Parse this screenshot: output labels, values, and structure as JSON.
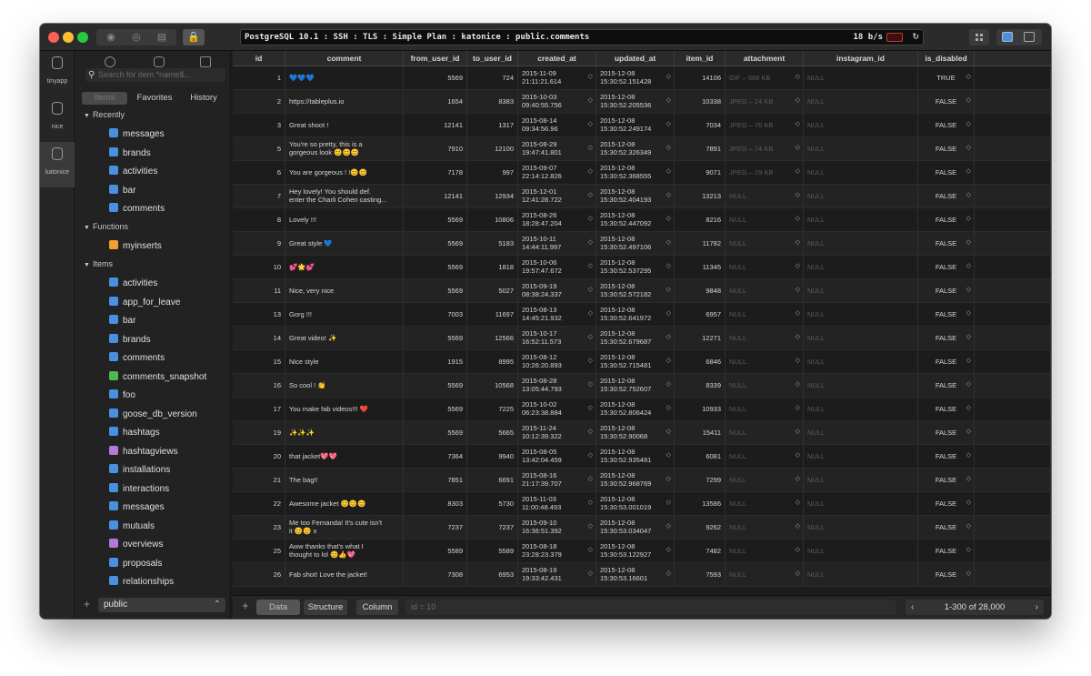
{
  "titlebar": {
    "connection": "PostgreSQL 10.1 : SSH : TLS : Simple Plan : katonice : public.comments",
    "speed": "18 b/s",
    "refresh_icon": "↻"
  },
  "rail": [
    {
      "label": "tinyapp"
    },
    {
      "label": "nice"
    },
    {
      "label": "katonice"
    }
  ],
  "sidebar": {
    "search_placeholder": "Search for item  *name$...",
    "segments": [
      "Items",
      "Favorites",
      "History"
    ],
    "groups": [
      {
        "title": "Recently",
        "items": [
          {
            "name": "messages",
            "color": "#4a90e2"
          },
          {
            "name": "brands",
            "color": "#4a90e2"
          },
          {
            "name": "activities",
            "color": "#4a90e2"
          },
          {
            "name": "bar",
            "color": "#4a90e2"
          },
          {
            "name": "comments",
            "color": "#4a90e2"
          }
        ]
      },
      {
        "title": "Functions",
        "items": [
          {
            "name": "myinserts",
            "color": "#f0a030"
          }
        ]
      },
      {
        "title": "Items",
        "items": [
          {
            "name": "activities",
            "color": "#4a90e2"
          },
          {
            "name": "app_for_leave",
            "color": "#4a90e2"
          },
          {
            "name": "bar",
            "color": "#4a90e2"
          },
          {
            "name": "brands",
            "color": "#4a90e2"
          },
          {
            "name": "comments",
            "color": "#4a90e2"
          },
          {
            "name": "comments_snapshot",
            "color": "#4cbb4c"
          },
          {
            "name": "foo",
            "color": "#4a90e2"
          },
          {
            "name": "goose_db_version",
            "color": "#4a90e2"
          },
          {
            "name": "hashtags",
            "color": "#4a90e2"
          },
          {
            "name": "hashtagviews",
            "color": "#b07ad8"
          },
          {
            "name": "installations",
            "color": "#4a90e2"
          },
          {
            "name": "interactions",
            "color": "#4a90e2"
          },
          {
            "name": "messages",
            "color": "#4a90e2"
          },
          {
            "name": "mutuals",
            "color": "#4a90e2"
          },
          {
            "name": "overviews",
            "color": "#b07ad8"
          },
          {
            "name": "proposals",
            "color": "#4a90e2"
          },
          {
            "name": "relationships",
            "color": "#4a90e2"
          }
        ]
      }
    ],
    "footer": {
      "add": "+",
      "schema": "public",
      "stepper": "⌃"
    }
  },
  "grid": {
    "columns": [
      "id",
      "comment",
      "from_user_id",
      "to_user_id",
      "created_at",
      "updated_at",
      "item_id",
      "attachment",
      "instagram_id",
      "is_disabled"
    ],
    "stepper": "◇",
    "rows": [
      {
        "id": "1",
        "comment": "💙💙💙",
        "from": "5569",
        "to": "724",
        "created": "2015-11-09\n21:11:21.614",
        "updated": "2015-12-08\n15:30:52.151428",
        "item": "14106",
        "attachment": "GIF – 588 KB",
        "instagram": "NULL",
        "disabled": "TRUE"
      },
      {
        "id": "2",
        "comment": "https://tableplus.io",
        "from": "1654",
        "to": "8383",
        "created": "2015-10-03\n09:40:55.756",
        "updated": "2015-12-08\n15:30:52.205536",
        "item": "10338",
        "attachment": "JPEG – 24 KB",
        "instagram": "NULL",
        "disabled": "FALSE"
      },
      {
        "id": "3",
        "comment": "Great shoot !",
        "from": "12141",
        "to": "1317",
        "created": "2015-08-14\n09:34:56.96",
        "updated": "2015-12-08\n15:30:52.249174",
        "item": "7034",
        "attachment": "JPEG – 76 KB",
        "instagram": "NULL",
        "disabled": "FALSE"
      },
      {
        "id": "5",
        "comment": "You're so pretty, this is a\ngorgeous look 😊😊😊",
        "from": "7910",
        "to": "12100",
        "created": "2015-08-29\n19:47:41.801",
        "updated": "2015-12-08\n15:30:52.326349",
        "item": "7891",
        "attachment": "JPEG – 74 KB",
        "instagram": "NULL",
        "disabled": "FALSE"
      },
      {
        "id": "6",
        "comment": "You are gorgeous ! !😊😊",
        "from": "7178",
        "to": "997",
        "created": "2015-09-07\n22:14:12.826",
        "updated": "2015-12-08\n15:30:52.368555",
        "item": "9071",
        "attachment": "JPEG – 29 KB",
        "instagram": "NULL",
        "disabled": "FALSE"
      },
      {
        "id": "7",
        "comment": "Hey lovely! You should def.\nenter the Charli Cohen casting...",
        "from": "12141",
        "to": "12934",
        "created": "2015-12-01\n12:41:28.722",
        "updated": "2015-12-08\n15:30:52.404193",
        "item": "13213",
        "attachment": "NULL",
        "instagram": "NULL",
        "disabled": "FALSE"
      },
      {
        "id": "8",
        "comment": "Lovely !!!",
        "from": "5569",
        "to": "10806",
        "created": "2015-08-26\n18:28:47.204",
        "updated": "2015-12-08\n15:30:52.447092",
        "item": "8216",
        "attachment": "NULL",
        "instagram": "NULL",
        "disabled": "FALSE"
      },
      {
        "id": "9",
        "comment": "Great style 💙",
        "from": "5569",
        "to": "5183",
        "created": "2015-10-11\n14:44:11.997",
        "updated": "2015-12-08\n15:30:52.497106",
        "item": "11782",
        "attachment": "NULL",
        "instagram": "NULL",
        "disabled": "FALSE"
      },
      {
        "id": "10",
        "comment": "💕🌟💕",
        "from": "5569",
        "to": "1818",
        "created": "2015-10-06\n19:57:47.672",
        "updated": "2015-12-08\n15:30:52.537295",
        "item": "11345",
        "attachment": "NULL",
        "instagram": "NULL",
        "disabled": "FALSE"
      },
      {
        "id": "11",
        "comment": "Nice, very nice",
        "from": "5569",
        "to": "5027",
        "created": "2015-09-19\n08:38:24.337",
        "updated": "2015-12-08\n15:30:52.572182",
        "item": "9848",
        "attachment": "NULL",
        "instagram": "NULL",
        "disabled": "FALSE"
      },
      {
        "id": "13",
        "comment": "Gorg !!!",
        "from": "7003",
        "to": "11697",
        "created": "2015-08-13\n14:45:21.932",
        "updated": "2015-12-08\n15:30:52.641972",
        "item": "6957",
        "attachment": "NULL",
        "instagram": "NULL",
        "disabled": "FALSE"
      },
      {
        "id": "14",
        "comment": "Great video! ✨",
        "from": "5569",
        "to": "12566",
        "created": "2015-10-17\n16:52:11.573",
        "updated": "2015-12-08\n15:30:52.679687",
        "item": "12271",
        "attachment": "NULL",
        "instagram": "NULL",
        "disabled": "FALSE"
      },
      {
        "id": "15",
        "comment": "Nice style",
        "from": "1915",
        "to": "8995",
        "created": "2015-08-12\n10:26:20.893",
        "updated": "2015-12-08\n15:30:52.715481",
        "item": "6846",
        "attachment": "NULL",
        "instagram": "NULL",
        "disabled": "FALSE"
      },
      {
        "id": "16",
        "comment": "So cool ! 👏",
        "from": "5569",
        "to": "10568",
        "created": "2015-08-28\n13:05:44.793",
        "updated": "2015-12-08\n15:30:52.752607",
        "item": "8339",
        "attachment": "NULL",
        "instagram": "NULL",
        "disabled": "FALSE"
      },
      {
        "id": "17",
        "comment": "You make fab videos!!! ❤️",
        "from": "5569",
        "to": "7225",
        "created": "2015-10-02\n06:23:38.884",
        "updated": "2015-12-08\n15:30:52.806424",
        "item": "10933",
        "attachment": "NULL",
        "instagram": "NULL",
        "disabled": "FALSE"
      },
      {
        "id": "19",
        "comment": "✨✨✨",
        "from": "5569",
        "to": "5665",
        "created": "2015-11-24\n10:12:39.322",
        "updated": "2015-12-08\n15:30:52.90068",
        "item": "15411",
        "attachment": "NULL",
        "instagram": "NULL",
        "disabled": "FALSE"
      },
      {
        "id": "20",
        "comment": "that jacket💖💖",
        "from": "7364",
        "to": "9940",
        "created": "2015-08-05\n13:42:04.459",
        "updated": "2015-12-08\n15:30:52.935481",
        "item": "6081",
        "attachment": "NULL",
        "instagram": "NULL",
        "disabled": "FALSE"
      },
      {
        "id": "21",
        "comment": "The bag!!",
        "from": "7851",
        "to": "6691",
        "created": "2015-08-16\n21:17:39.707",
        "updated": "2015-12-08\n15:30:52.968769",
        "item": "7299",
        "attachment": "NULL",
        "instagram": "NULL",
        "disabled": "FALSE"
      },
      {
        "id": "22",
        "comment": "Awesome jacket 😊😊😊",
        "from": "8303",
        "to": "5730",
        "created": "2015-11-03\n11:00:48.493",
        "updated": "2015-12-08\n15:30:53.001019",
        "item": "13586",
        "attachment": "NULL",
        "instagram": "NULL",
        "disabled": "FALSE"
      },
      {
        "id": "23",
        "comment": "Me too Fernanda! It's cute isn't\nit 😊😊 x",
        "from": "7237",
        "to": "7237",
        "created": "2015-09-10\n16:36:51.392",
        "updated": "2015-12-08\n15:30:53.034047",
        "item": "9262",
        "attachment": "NULL",
        "instagram": "NULL",
        "disabled": "FALSE"
      },
      {
        "id": "25",
        "comment": "Aww thanks that's what I\nthought to lol 😊👍💖",
        "from": "5589",
        "to": "5589",
        "created": "2015-08-18\n23:28:23.379",
        "updated": "2015-12-08\n15:30:53.122927",
        "item": "7482",
        "attachment": "NULL",
        "instagram": "NULL",
        "disabled": "FALSE"
      },
      {
        "id": "26",
        "comment": "Fab shot! Love the jacket!",
        "from": "7308",
        "to": "6953",
        "created": "2015-08-19\n19:33:42.431",
        "updated": "2015-12-08\n15:30:53.16601",
        "item": "7593",
        "attachment": "NULL",
        "instagram": "NULL",
        "disabled": "FALSE"
      }
    ]
  },
  "bottom": {
    "add": "+",
    "tabs": [
      "Data",
      "Structure",
      "Column"
    ],
    "filter_placeholder": "id = 10",
    "pager": "1-300 of 28,000",
    "prev": "‹",
    "next": "›"
  },
  "icons": {
    "search": "search-icon",
    "database": "database-icon",
    "lock": "lock-icon",
    "refresh": "refresh-icon"
  }
}
